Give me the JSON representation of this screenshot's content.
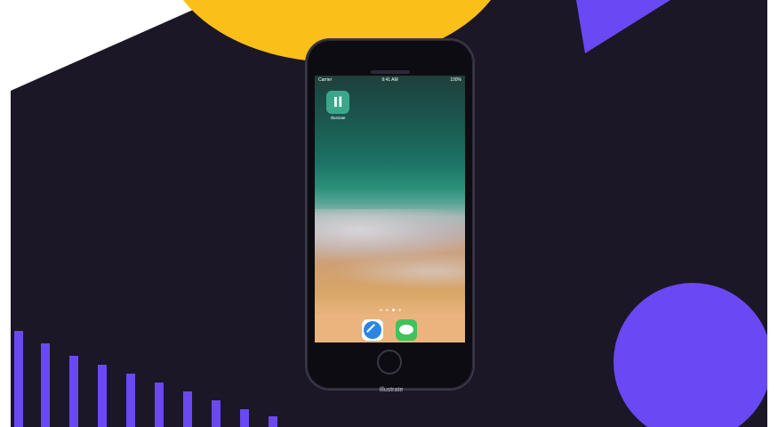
{
  "colors": {
    "background": "#1b1726",
    "yellow": "#fbbf1a",
    "purple": "#6a48f4",
    "app_icon": "#3aa78b"
  },
  "status_bar": {
    "carrier": "Carrier",
    "time": "9:41 AM",
    "battery": "100%"
  },
  "home_screen": {
    "apps": [
      {
        "label": "Illustrate",
        "icon": "il-logo-icon",
        "glyph": "Il"
      }
    ],
    "page_dots": 4,
    "active_page": 3,
    "dock": [
      {
        "icon": "safari-icon"
      },
      {
        "icon": "messages-icon"
      }
    ]
  },
  "caption": "Illustrate"
}
